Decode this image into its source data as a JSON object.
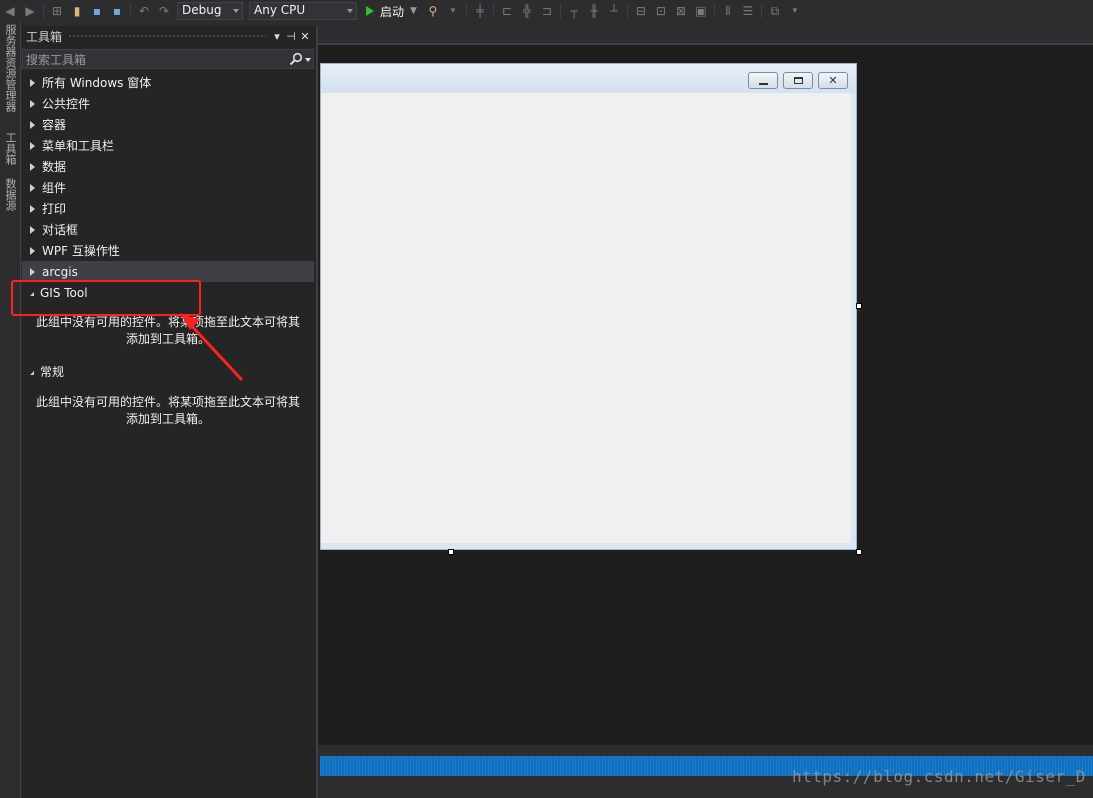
{
  "toolbar": {
    "config_value": "Debug",
    "platform_value": "Any CPU",
    "start_label": "启动"
  },
  "vertical_tabs": [
    "服务器资源管理器",
    "工具箱",
    "数据源"
  ],
  "toolbox": {
    "title": "工具箱",
    "search_placeholder": "搜索工具箱",
    "categories": [
      {
        "label": "所有 Windows 窗体",
        "expanded": false
      },
      {
        "label": "公共控件",
        "expanded": false
      },
      {
        "label": "容器",
        "expanded": false
      },
      {
        "label": "菜单和工具栏",
        "expanded": false
      },
      {
        "label": "数据",
        "expanded": false
      },
      {
        "label": "组件",
        "expanded": false
      },
      {
        "label": "打印",
        "expanded": false
      },
      {
        "label": "对话框",
        "expanded": false
      },
      {
        "label": "WPF 互操作性",
        "expanded": false
      },
      {
        "label": "arcgis",
        "expanded": false,
        "selected": true
      }
    ],
    "gis_group": {
      "label": "GIS Tool",
      "empty_message": "此组中没有可用的控件。将某项拖至此文本可将其添加到工具箱。"
    },
    "general_group": {
      "label": "常规",
      "empty_message": "此组中没有可用的控件。将某项拖至此文本可将其添加到工具箱。"
    }
  },
  "watermark": "https://blog.csdn.net/Giser_D",
  "colors": {
    "highlight_box": "#ff2020",
    "status_bar": "#0e70c0",
    "run_icon": "#31c12b"
  }
}
